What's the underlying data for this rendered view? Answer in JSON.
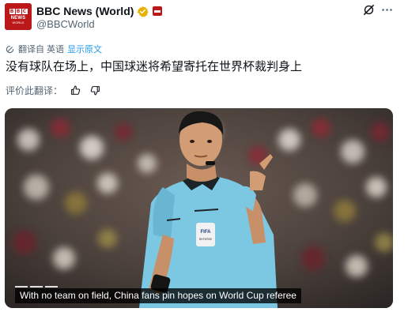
{
  "account": {
    "display_name": "BBC News (World)",
    "handle": "@BBCWorld",
    "avatar_letters": [
      "B",
      "B",
      "C"
    ],
    "avatar_line1": "NEWS",
    "avatar_line2": "WORLD",
    "verified_color": "#e8b000",
    "brand_color": "#bb1919"
  },
  "translation": {
    "translated_from": "翻译自 英语",
    "show_original": "显示原文",
    "icon": "translate-icon"
  },
  "tweet": {
    "text": "没有球队在场上，中国球迷将希望寄托在世界杯裁判身上"
  },
  "rating": {
    "label": "评价此翻译：",
    "like_icon": "thumbs-up-icon",
    "dislike_icon": "thumbs-down-icon"
  },
  "header_icons": {
    "grok": "grok-icon",
    "more": "more-icon"
  },
  "media": {
    "caption": "With no team on field, China fans pin hopes on World Cup referee",
    "badge_text": "FIFA",
    "badge_subtext": "REFEREE",
    "jersey_color": "#7cc8e3",
    "link_color": "#1d9bf0"
  }
}
